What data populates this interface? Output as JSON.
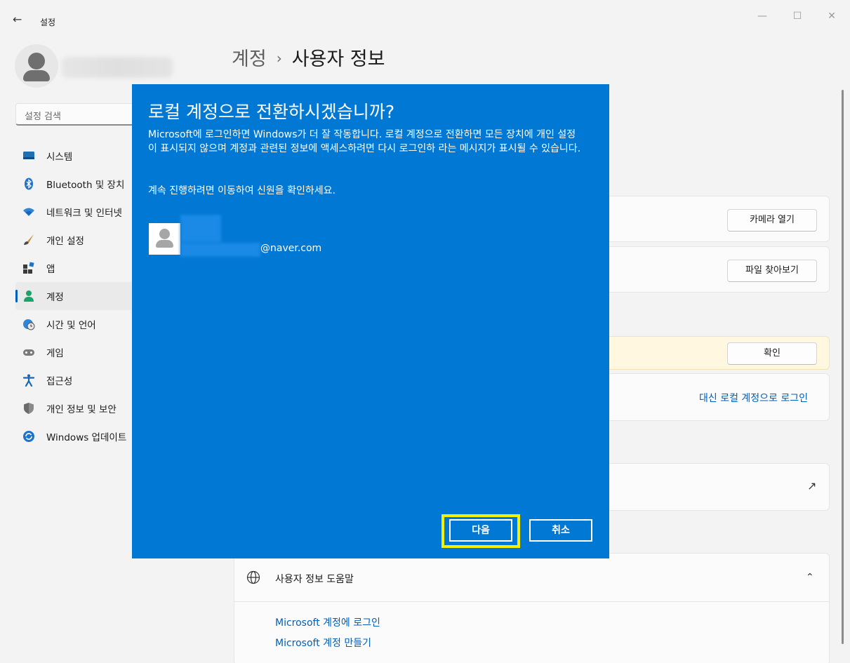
{
  "window": {
    "app_title": "설정",
    "back_icon": "←",
    "minimize_icon": "—",
    "maximize_icon": "☐",
    "close_icon": "✕"
  },
  "sidebar": {
    "search_placeholder": "설정 검색",
    "items": [
      {
        "label": "시스템",
        "icon": "system-icon"
      },
      {
        "label": "Bluetooth 및 장치",
        "icon": "bluetooth-icon"
      },
      {
        "label": "네트워크 및 인터넷",
        "icon": "wifi-icon"
      },
      {
        "label": "개인 설정",
        "icon": "brush-icon"
      },
      {
        "label": "앱",
        "icon": "apps-icon"
      },
      {
        "label": "계정",
        "icon": "account-icon",
        "selected": true
      },
      {
        "label": "시간 및 언어",
        "icon": "globe-clock-icon"
      },
      {
        "label": "게임",
        "icon": "gamepad-icon"
      },
      {
        "label": "접근성",
        "icon": "accessibility-icon"
      },
      {
        "label": "개인 정보 및 보안",
        "icon": "shield-icon"
      },
      {
        "label": "Windows 업데이트",
        "icon": "update-icon"
      }
    ]
  },
  "main": {
    "breadcrumb_parent": "계정",
    "breadcrumb_sep": "›",
    "breadcrumb_current": "사용자 정보",
    "camera_button": "카메라 열기",
    "browse_button": "파일 찾아보기",
    "confirm_button": "확인",
    "local_link": "대신 로컬 계정으로 로그인",
    "external_icon": "↗",
    "help_title": "사용자 정보 도움말",
    "help_chevron": "⌃",
    "help_links": [
      "Microsoft 계정에 로그인",
      "Microsoft 계정 만들기"
    ]
  },
  "dialog": {
    "title": "로컬 계정으로 전환하시겠습니까?",
    "body": "Microsoft에 로그인하면 Windows가 더 잘 작동합니다. 로컬 계정으로 전환하면 모든 장치에 개인 설정이 표시되지 않으며 계정과 관련된 정보에 액세스하려면 다시 로그인하 라는 메시지가 표시될 수 있습니다.",
    "body2": "계속 진행하려면 이동하여 신원을 확인하세요.",
    "email": "@naver.com",
    "next_button": "다음",
    "cancel_button": "취소",
    "focus_color": "#f5f000",
    "bg_color": "#0078d4"
  }
}
